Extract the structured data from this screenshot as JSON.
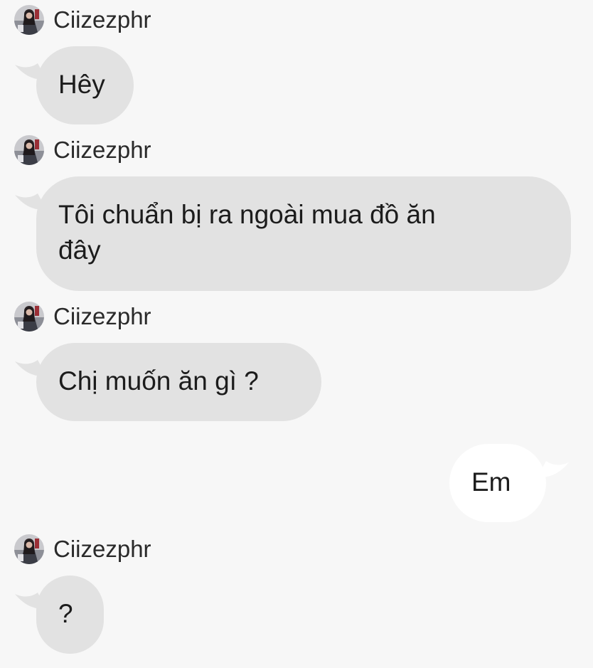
{
  "conversation": {
    "sender_name": "Ciizezphr",
    "messages": [
      {
        "direction": "incoming",
        "text": "Hêy"
      },
      {
        "direction": "incoming",
        "text_line1": "Tôi chuẩn bị ra ngoài mua đồ ăn",
        "text_line2": "đây"
      },
      {
        "direction": "incoming",
        "text": "Chị muốn ăn gì ?"
      },
      {
        "direction": "outgoing",
        "text": "Em"
      },
      {
        "direction": "incoming",
        "text": "?"
      }
    ]
  },
  "colors": {
    "background": "#f7f7f7",
    "incoming_bubble": "#e2e2e2",
    "outgoing_bubble": "#ffffff",
    "text": "#1c1c1c"
  },
  "icons": {
    "avatar": "profile-photo-avatar",
    "bubble_tail": "speech-bubble-tail"
  }
}
